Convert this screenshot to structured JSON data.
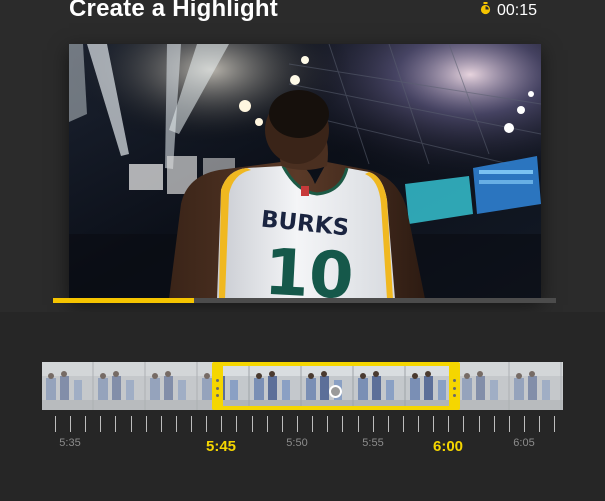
{
  "header": {
    "title": "Create a Highlight",
    "timer": "00:15",
    "timer_icon": "stopwatch-icon"
  },
  "video": {
    "jersey_name": "BURKS",
    "jersey_number": "10",
    "progress_fraction": 0.28
  },
  "timeline": {
    "labels": [
      {
        "text": "5:35",
        "highlight": false
      },
      {
        "text": "5:45",
        "highlight": true
      },
      {
        "text": "5:50",
        "highlight": false
      },
      {
        "text": "5:55",
        "highlight": false
      },
      {
        "text": "6:00",
        "highlight": true
      },
      {
        "text": "6:05",
        "highlight": false
      }
    ],
    "selection_start": "5:45",
    "selection_end": "6:00"
  },
  "colors": {
    "accent": "#f5d600",
    "progress": "#f5c400",
    "background": "#2b2b2b"
  }
}
